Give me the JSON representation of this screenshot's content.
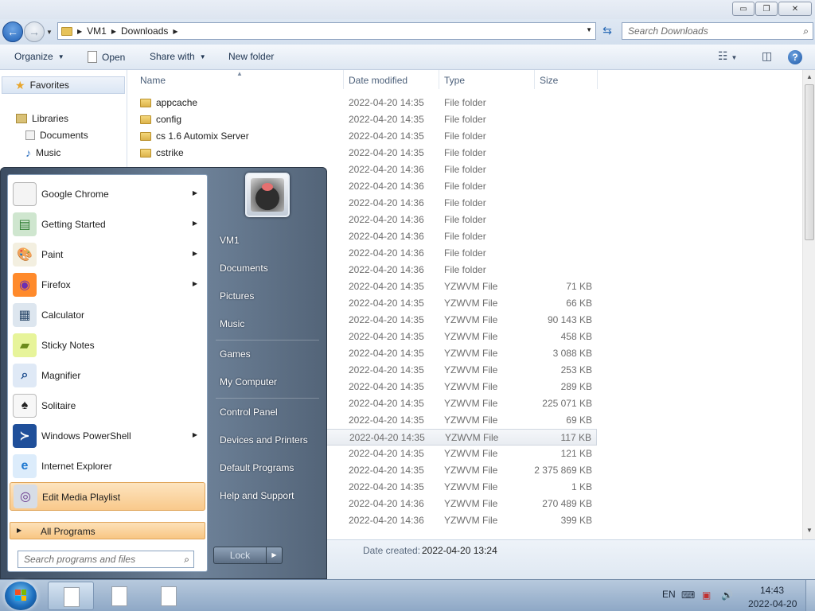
{
  "window": {
    "minimize": "▭",
    "maximize": "❐",
    "close": "✕"
  },
  "address": {
    "crumbs": [
      "VM1",
      "Downloads"
    ],
    "search_placeholder": "Search Downloads"
  },
  "toolbar": {
    "organize": "Organize",
    "open": "Open",
    "share_with": "Share with",
    "new_folder": "New folder"
  },
  "navpane": {
    "favorites": "Favorites",
    "libraries": "Libraries",
    "documents": "Documents",
    "music": "Music"
  },
  "columns": {
    "name": "Name",
    "date": "Date modified",
    "type": "Type",
    "size": "Size"
  },
  "files": [
    {
      "name": "appcache",
      "date": "2022-04-20 14:35",
      "type": "File folder",
      "size": ""
    },
    {
      "name": "config",
      "date": "2022-04-20 14:35",
      "type": "File folder",
      "size": ""
    },
    {
      "name": "cs 1.6 Automix Server",
      "date": "2022-04-20 14:35",
      "type": "File folder",
      "size": ""
    },
    {
      "name": "cstrike",
      "date": "2022-04-20 14:35",
      "type": "File folder",
      "size": ""
    },
    {
      "name": "",
      "date": "2022-04-20 14:36",
      "type": "File folder",
      "size": ""
    },
    {
      "name": "",
      "date": "2022-04-20 14:36",
      "type": "File folder",
      "size": ""
    },
    {
      "name": "",
      "date": "2022-04-20 14:36",
      "type": "File folder",
      "size": ""
    },
    {
      "name": "",
      "date": "2022-04-20 14:36",
      "type": "File folder",
      "size": ""
    },
    {
      "name": "",
      "date": "2022-04-20 14:36",
      "type": "File folder",
      "size": ""
    },
    {
      "name": "",
      "date": "2022-04-20 14:36",
      "type": "File folder",
      "size": ""
    },
    {
      "name": "",
      "date": "2022-04-20 14:36",
      "type": "File folder",
      "size": ""
    },
    {
      "name": "",
      "date": "2022-04-20 14:35",
      "type": "YZWVM File",
      "size": "71 KB"
    },
    {
      "name": "",
      "date": "2022-04-20 14:35",
      "type": "YZWVM File",
      "size": "66 KB"
    },
    {
      "name": "",
      "date": "2022-04-20 14:35",
      "type": "YZWVM File",
      "size": "90 143 KB"
    },
    {
      "name": "",
      "date": "2022-04-20 14:35",
      "type": "YZWVM File",
      "size": "458 KB"
    },
    {
      "name": "",
      "date": "2022-04-20 14:35",
      "type": "YZWVM File",
      "size": "3 088 KB"
    },
    {
      "name": "",
      "date": "2022-04-20 14:35",
      "type": "YZWVM File",
      "size": "253 KB"
    },
    {
      "name": "",
      "date": "2022-04-20 14:35",
      "type": "YZWVM File",
      "size": "289 KB"
    },
    {
      "name": "",
      "date": "2022-04-20 14:35",
      "type": "YZWVM File",
      "size": "225 071 KB"
    },
    {
      "name": "",
      "date": "2022-04-20 14:35",
      "type": "YZWVM File",
      "size": "69 KB"
    },
    {
      "name": "",
      "date": "2022-04-20 14:35",
      "type": "YZWVM File",
      "size": "117 KB"
    },
    {
      "name": "",
      "date": "2022-04-20 14:35",
      "type": "YZWVM File",
      "size": "121 KB"
    },
    {
      "name": "",
      "date": "2022-04-20 14:35",
      "type": "YZWVM File",
      "size": "2 375 869 KB"
    },
    {
      "name": "",
      "date": "2022-04-20 14:35",
      "type": "YZWVM File",
      "size": "1 KB"
    },
    {
      "name": "",
      "date": "2022-04-20 14:36",
      "type": "YZWVM File",
      "size": "270 489 KB"
    },
    {
      "name": "",
      "date": "2022-04-20 14:36",
      "type": "YZWVM File",
      "size": "399 KB"
    }
  ],
  "details": {
    "label": "Date created:",
    "value": "2022-04-20 13:24"
  },
  "startmenu": {
    "programs": [
      {
        "label": "Google Chrome",
        "icon": "chrome-icon",
        "submenu": true
      },
      {
        "label": "Getting Started",
        "icon": "getting-started-icon",
        "submenu": true
      },
      {
        "label": "Paint",
        "icon": "paint-icon",
        "submenu": true
      },
      {
        "label": "Firefox",
        "icon": "firefox-icon",
        "submenu": true
      },
      {
        "label": "Calculator",
        "icon": "calculator-icon",
        "submenu": false
      },
      {
        "label": "Sticky Notes",
        "icon": "sticky-notes-icon",
        "submenu": false
      },
      {
        "label": "Magnifier",
        "icon": "magnifier-icon",
        "submenu": false
      },
      {
        "label": "Solitaire",
        "icon": "solitaire-icon",
        "submenu": false
      },
      {
        "label": "Windows PowerShell",
        "icon": "powershell-icon",
        "submenu": true
      },
      {
        "label": "Internet Explorer",
        "icon": "internet-explorer-icon",
        "submenu": false
      },
      {
        "label": "Edit Media Playlist",
        "icon": "media-playlist-icon",
        "submenu": false
      }
    ],
    "all_programs": "All Programs",
    "search_placeholder": "Search programs and files",
    "right": {
      "user": "VM1",
      "documents": "Documents",
      "pictures": "Pictures",
      "music": "Music",
      "games": "Games",
      "computer": "My Computer",
      "control_panel": "Control Panel",
      "devices": "Devices and Printers",
      "defaults": "Default Programs",
      "help": "Help and Support"
    },
    "lock": "Lock"
  },
  "taskbar": {
    "lang": "EN",
    "time": "14:43",
    "date": "2022-04-20"
  },
  "colors": {
    "highlight": "#f9c98b",
    "folder": "#dcb34b",
    "accent": "#1d5fb5"
  }
}
